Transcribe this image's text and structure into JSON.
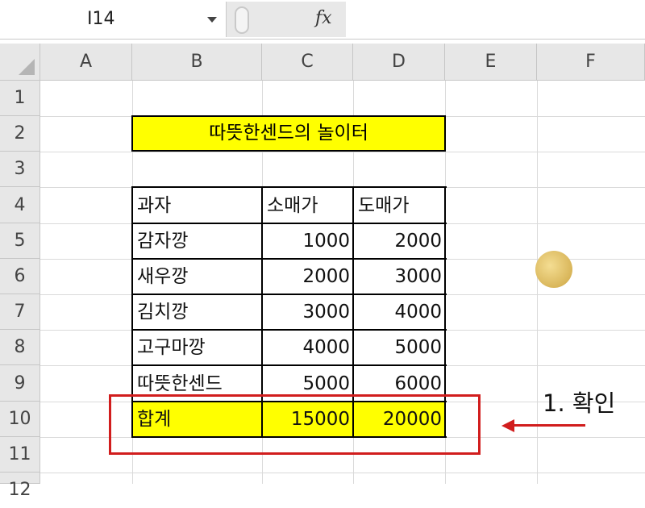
{
  "formula_bar": {
    "name_box": "I14",
    "fx": "fx",
    "formula": ""
  },
  "columns": [
    "A",
    "B",
    "C",
    "D",
    "E",
    "F"
  ],
  "rows": [
    "1",
    "2",
    "3",
    "4",
    "5",
    "6",
    "7",
    "8",
    "9",
    "10",
    "11",
    "12"
  ],
  "title": "따뜻한센드의 놀이터",
  "table": {
    "header": [
      "과자",
      "소매가",
      "도매가"
    ],
    "rows": [
      [
        "감자깡",
        "1000",
        "2000"
      ],
      [
        "새우깡",
        "2000",
        "3000"
      ],
      [
        "김치깡",
        "3000",
        "4000"
      ],
      [
        "고구마깡",
        "4000",
        "5000"
      ],
      [
        "따뜻한센드",
        "5000",
        "6000"
      ]
    ],
    "total": [
      "합계",
      "15000",
      "20000"
    ]
  },
  "logo_text": "따뜻한센드",
  "annotation": {
    "label": "1. 확인",
    "color": "#d11d1d"
  },
  "colors": {
    "highlight": "#ffff00",
    "annotation": "#d11d1d"
  }
}
